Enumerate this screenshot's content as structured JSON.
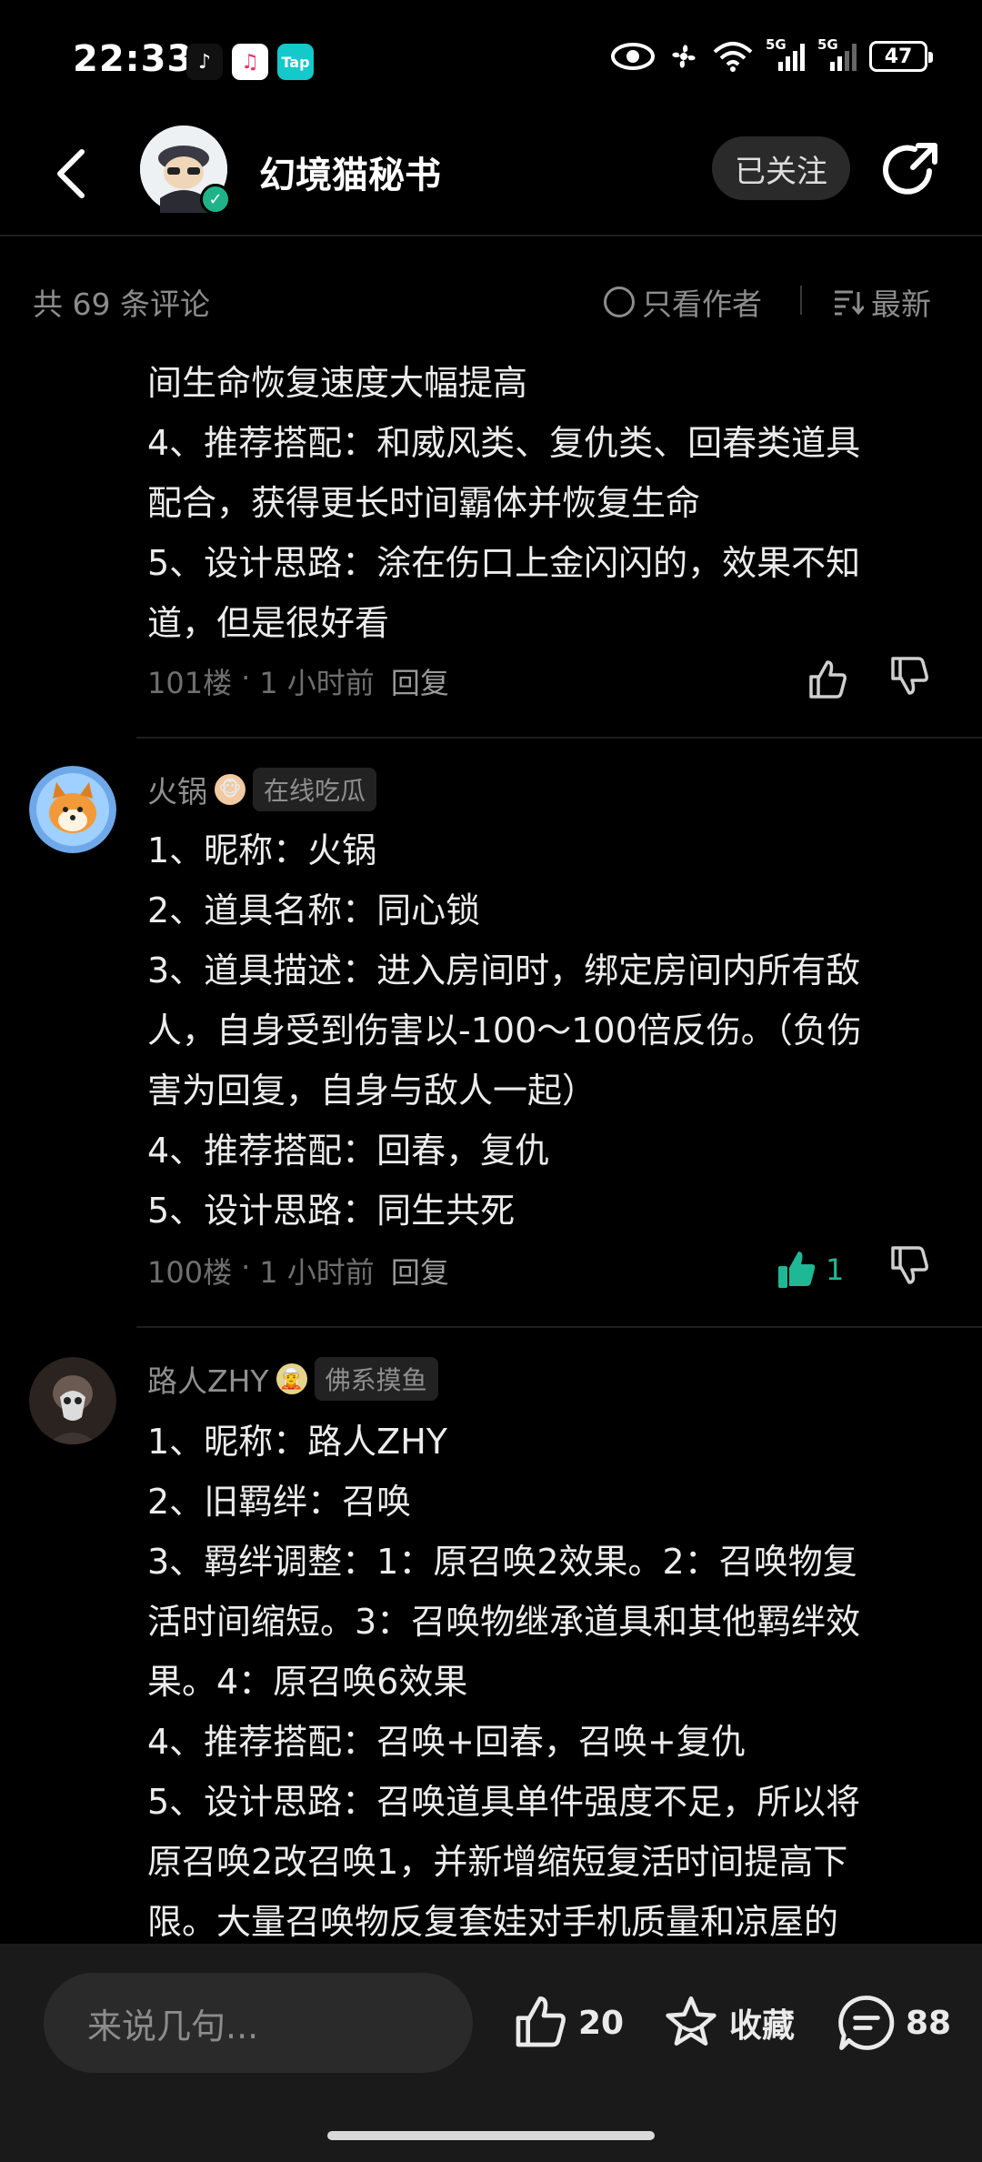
{
  "status_bar": {
    "time": "22:33",
    "network_1": "5G",
    "network_2": "5G",
    "battery": "47"
  },
  "header": {
    "title": "幻境猫秘书",
    "follow_label": "已关注"
  },
  "filter": {
    "count_label": "共 69 条评论",
    "author_only_label": "只看作者",
    "sort_label": "最新"
  },
  "comments": [
    {
      "lines": [
        "间生命恢复速度大幅提高",
        "4、推荐搭配：和威风类、复仇类、回春类道具",
        "配合，获得更长时间霸体并恢复生命",
        "5、设计思路：涂在伤口上金闪闪的，效果不知",
        "道，但是很好看"
      ],
      "floor": "101楼",
      "time": "1 小时前",
      "reply_label": "回复"
    },
    {
      "username": "火锅",
      "title_badge": "在线吃瓜",
      "lines": [
        "1、昵称：火锅",
        "2、道具名称：同心锁",
        "3、道具描述：进入房间时，绑定房间内所有敌",
        "人，自身受到伤害以-100～100倍反伤。（负伤",
        "害为回复，自身与敌人一起）",
        "4、推荐搭配：回春，复仇",
        "5、设计思路：同生共死"
      ],
      "floor": "100楼",
      "time": "1 小时前",
      "reply_label": "回复",
      "likes": "1"
    },
    {
      "username": "路人ZHY",
      "title_badge": "佛系摸鱼",
      "lines": [
        "1、昵称：路人ZHY",
        "2、旧羁绊：召唤",
        "3、羁绊调整：1：原召唤2效果。2：召唤物复",
        "活时间缩短。3：召唤物继承道具和其他羁绊效",
        "果。4：原召唤6效果",
        "4、推荐搭配：召唤+回春，召唤+复仇",
        "5、设计思路：召唤道具单件强度不足，所以将",
        "原召唤2改召唤1，并新增缩短复活时间提高下",
        "限。大量召唤物反复套娃对手机质量和凉屋的"
      ]
    }
  ],
  "bottom_bar": {
    "input_placeholder": "来说几句...",
    "likes": "20",
    "favorite_label": "收藏",
    "comments": "88"
  },
  "colors": {
    "background": "#000000",
    "accent": "#1fb894",
    "muted_text": "#8c8c8c"
  }
}
